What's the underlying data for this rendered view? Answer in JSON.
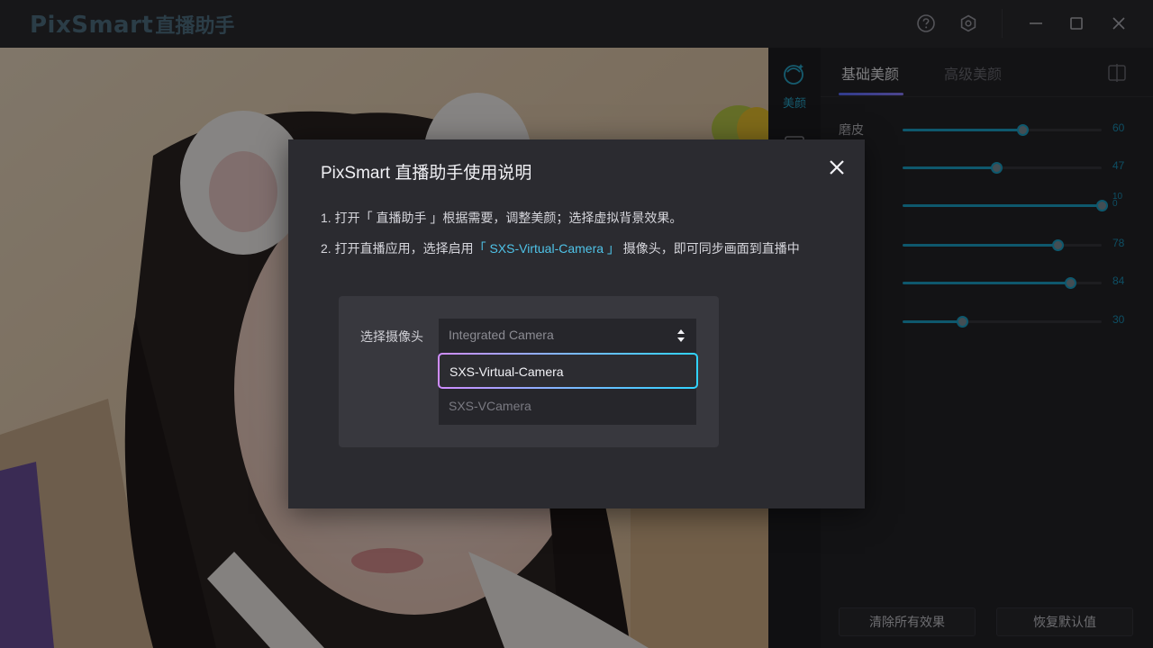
{
  "app": {
    "brand": "PixSmart",
    "brand_cn": "直播助手"
  },
  "titlebar": {
    "icons": [
      "help-icon",
      "settings-icon",
      "minimize-icon",
      "maximize-icon",
      "close-icon"
    ]
  },
  "rail": {
    "items": [
      {
        "label": "美颜",
        "icon": "beauty-face-icon",
        "active": true
      }
    ]
  },
  "panel": {
    "tabs": [
      {
        "label": "基础美颜",
        "active": true
      },
      {
        "label": "高级美颜",
        "active": false
      }
    ],
    "sliders": [
      {
        "label": "磨皮",
        "value": 60
      },
      {
        "label": "",
        "value": 47
      },
      {
        "label": "",
        "value": "10\n0",
        "display": "10 0",
        "fraction": 1.0
      },
      {
        "label": "",
        "value": 78
      },
      {
        "label": "",
        "value": 84
      },
      {
        "label": "",
        "value": 30
      }
    ],
    "footer": {
      "clear_label": "清除所有效果",
      "reset_label": "恢复默认值"
    }
  },
  "dialog": {
    "title": "PixSmart 直播助手使用说明",
    "step1": "1. 打开「 直播助手 」根据需要，调整美颜；选择虚拟背景效果。",
    "step2_prefix": "2. 打开直播应用，选择启用",
    "step2_highlight": "「 SXS-Virtual-Camera 」",
    "step2_suffix": " 摄像头，即可同步画面到直播中",
    "camera_label": "选择摄像头",
    "select_value": "Integrated Camera",
    "options": [
      "SXS-Virtual-Camera",
      "SXS-VCamera"
    ]
  },
  "colors": {
    "accent": "#1aa0c7",
    "highlight": "#4fc3e8",
    "tab_underline": "#6a5cff"
  }
}
